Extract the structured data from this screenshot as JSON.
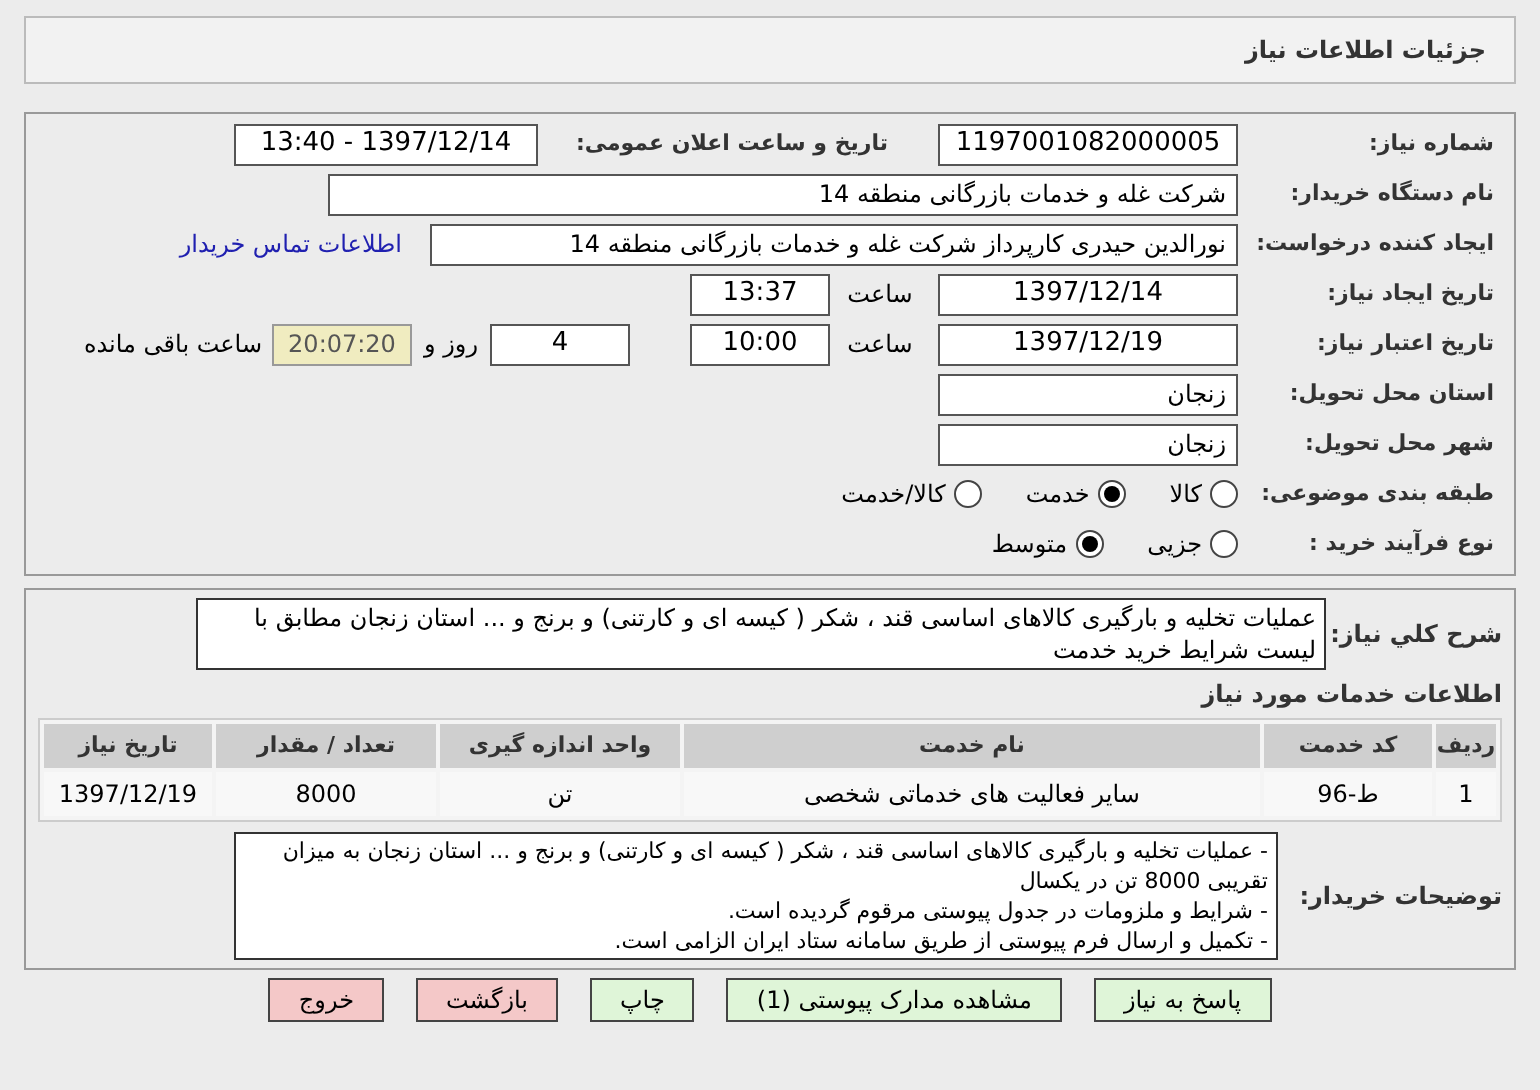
{
  "header": {
    "title": "جزئیات اطلاعات نیاز"
  },
  "details": {
    "need_number": {
      "label": "شماره نیاز:",
      "value": "1197001082000005"
    },
    "announce": {
      "label": "تاریخ و ساعت اعلان عمومی:",
      "value": "1397/12/14 - 13:40"
    },
    "buyer_org": {
      "label": "نام دستگاه خریدار:",
      "value": "شرکت غله و خدمات بازرگانی منطقه 14"
    },
    "creator": {
      "label": "ایجاد کننده درخواست:",
      "value": "نورالدین حیدری کارپرداز شرکت غله و خدمات بازرگانی منطقه 14",
      "link": "اطلاعات تماس خریدار"
    },
    "created": {
      "label": "تاریخ ایجاد نیاز:",
      "date": "1397/12/14",
      "time_label": "ساعت",
      "time": "13:37"
    },
    "validity": {
      "label": "تاریخ اعتبار نیاز:",
      "date": "1397/12/19",
      "time_label": "ساعت",
      "time": "10:00",
      "days": "4",
      "days_label": "روز و",
      "remaining": "20:07:20",
      "remaining_label": "ساعت باقی مانده"
    },
    "province": {
      "label": "استان محل تحویل:",
      "value": "زنجان"
    },
    "city": {
      "label": "شهر محل تحویل:",
      "value": "زنجان"
    },
    "category": {
      "label": "طبقه بندی موضوعی:",
      "options": [
        {
          "label": "کالا",
          "selected": false
        },
        {
          "label": "خدمت",
          "selected": true
        },
        {
          "label": "کالا/خدمت",
          "selected": false
        }
      ]
    },
    "process": {
      "label": "نوع فرآیند خرید :",
      "options": [
        {
          "label": "جزیی",
          "selected": false
        },
        {
          "label": "متوسط",
          "selected": true
        }
      ]
    }
  },
  "summary": {
    "label": "شرح کلي نياز:",
    "value": "عملیات تخلیه و بارگیری کالاهای اساسی  قند ، شکر ( کیسه ای و کارتنی) و برنج و ... استان زنجان مطابق با لیست شرایط خرید خدمت"
  },
  "services": {
    "heading": "اطلاعات خدمات مورد نیاز",
    "columns": [
      "ردیف",
      "کد خدمت",
      "نام خدمت",
      "واحد اندازه گیری",
      "تعداد / مقدار",
      "تاریخ نیاز"
    ],
    "rows": [
      [
        "1",
        "ط-96",
        "سایر فعالیت های خدماتی شخصی",
        "تن",
        "8000",
        "1397/12/19"
      ]
    ]
  },
  "buyer_notes": {
    "label": "توضیحات خریدار:",
    "lines": [
      "- عملیات تخلیه و بارگیری کالاهای اساسی  قند ، شکر ( کیسه ای و کارتنی) و برنج و ... استان زنجان به میزان تقریبی 8000 تن در یکسال",
      "- شرایط و ملزومات در جدول پیوستی مرقوم گردیده است.",
      "- تکمیل و ارسال فرم پیوستی از طریق سامانه ستاد ایران الزامی است."
    ]
  },
  "buttons": [
    {
      "label": "پاسخ به نیاز",
      "kind": "action"
    },
    {
      "label": "مشاهده مدارک پیوستی (1)",
      "kind": "action"
    },
    {
      "label": "چاپ",
      "kind": "action"
    },
    {
      "label": "بازگشت",
      "kind": "exit"
    },
    {
      "label": "خروج",
      "kind": "exit"
    }
  ]
}
